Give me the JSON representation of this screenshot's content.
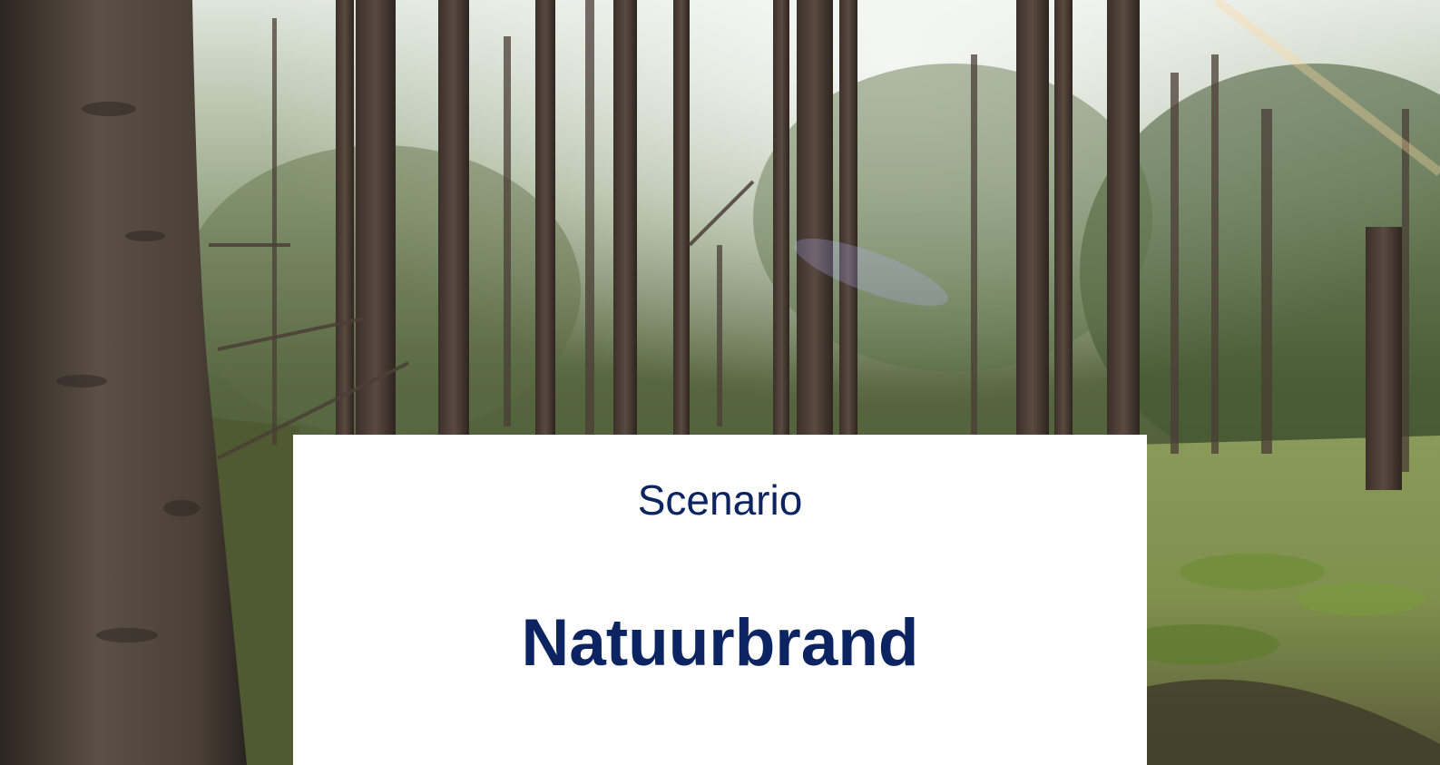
{
  "slide": {
    "subtitle": "Scenario",
    "title": "Natuurbrand"
  },
  "colors": {
    "text": "#0c2461",
    "card": "#ffffff"
  }
}
